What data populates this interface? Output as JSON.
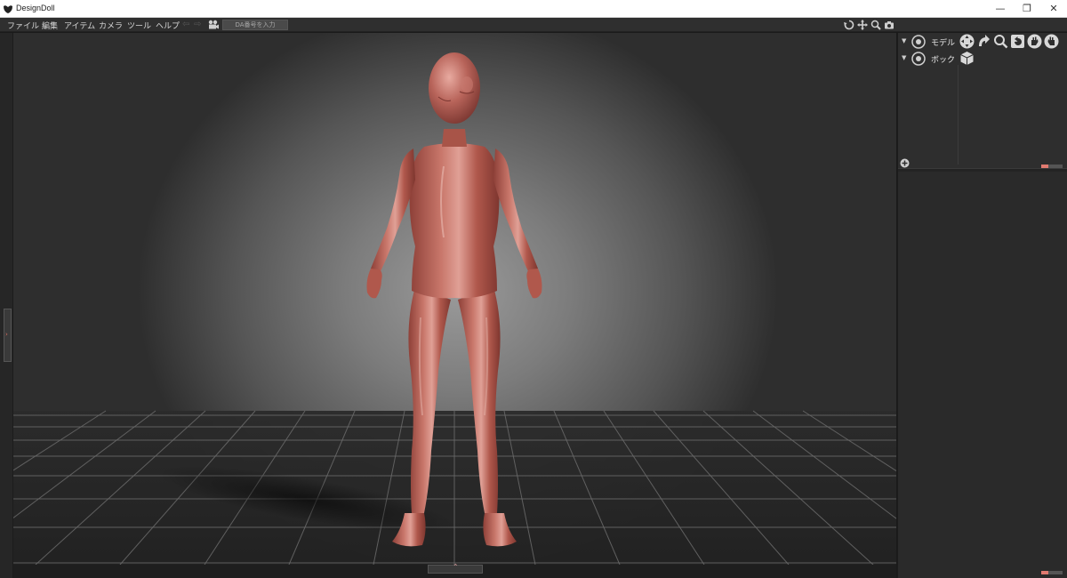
{
  "window": {
    "title": "DesignDoll",
    "minimize": "—",
    "maximize": "❐",
    "close": "✕"
  },
  "menu": {
    "items": [
      {
        "label": "ファイル"
      },
      {
        "label": "編集"
      },
      {
        "label": "アイテム"
      },
      {
        "label": "カメラ"
      },
      {
        "label": "ツール"
      },
      {
        "label": "ヘルプ"
      }
    ],
    "da_input_placeholder": "DA番号を入力"
  },
  "scene_tree": {
    "rows": [
      {
        "label": "モデル"
      },
      {
        "label": "ボック"
      }
    ]
  },
  "colors": {
    "accent": "#e07a70",
    "menubar": "#2f2f2f",
    "panel": "#2b2b2b",
    "doll": "#b25a4e"
  }
}
